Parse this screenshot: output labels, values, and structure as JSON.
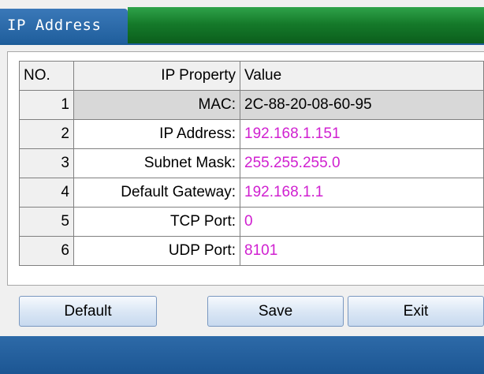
{
  "window": {
    "title": "IP Address"
  },
  "table": {
    "headers": {
      "no": "NO.",
      "property": "IP Property",
      "value": "Value"
    },
    "rows": [
      {
        "no": "1",
        "property": "MAC:",
        "value": "2C-88-20-08-60-95"
      },
      {
        "no": "2",
        "property": "IP Address:",
        "value": "192.168.1.151"
      },
      {
        "no": "3",
        "property": "Subnet Mask:",
        "value": "255.255.255.0"
      },
      {
        "no": "4",
        "property": "Default Gateway:",
        "value": "192.168.1.1"
      },
      {
        "no": "5",
        "property": "TCP Port:",
        "value": "0"
      },
      {
        "no": "6",
        "property": "UDP Port:",
        "value": "8101"
      }
    ]
  },
  "buttons": {
    "default": "Default",
    "save": "Save",
    "exit": "Exit"
  },
  "colors": {
    "title_tab": "#1f5e9c",
    "title_bar": "#157a2a",
    "value_text": "#d020d0",
    "bottom_bar": "#1c5693"
  }
}
